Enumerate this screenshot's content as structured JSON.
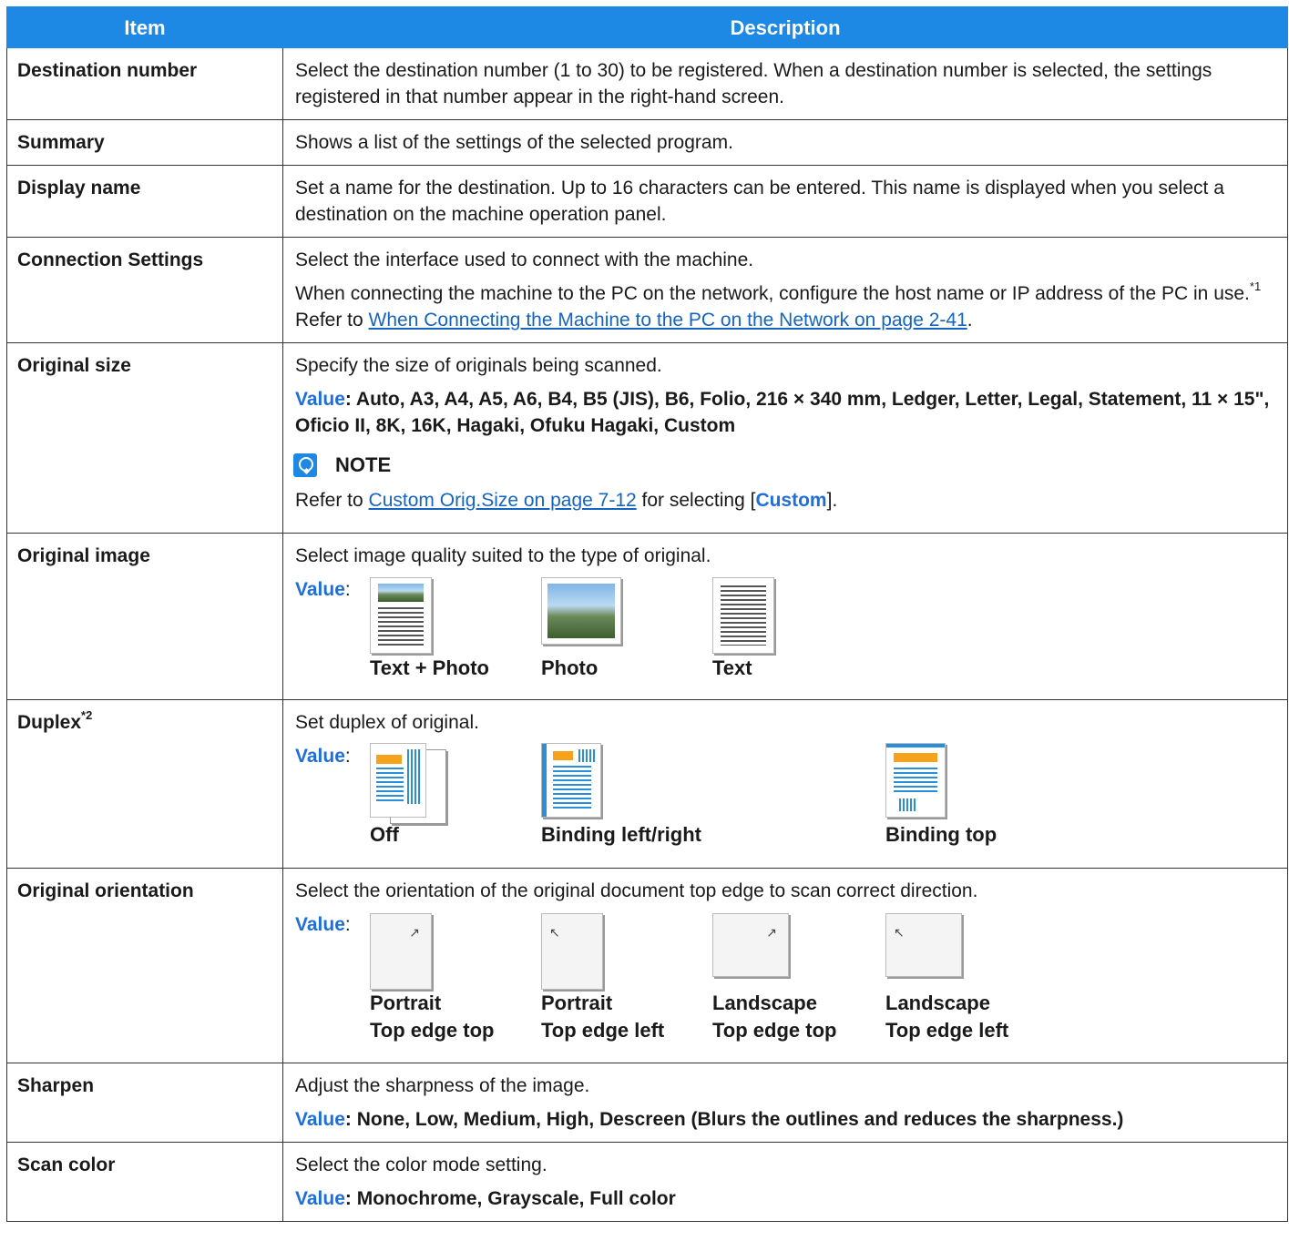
{
  "header": {
    "item": "Item",
    "description": "Description"
  },
  "rows": {
    "destination_number": {
      "item": "Destination number",
      "desc": "Select the destination number (1 to 30) to be registered. When a destination number is selected, the settings registered in that number appear in the right-hand screen."
    },
    "summary": {
      "item": "Summary",
      "desc": "Shows a list of the settings of the selected program."
    },
    "display_name": {
      "item": "Display name",
      "desc": "Set a name for the destination. Up to 16 characters can be entered. This name is displayed when you select a destination on the machine operation panel."
    },
    "connection_settings": {
      "item": "Connection Settings",
      "desc1": "Select the interface used to connect with the machine.",
      "desc2a": "When connecting the machine to the PC on the network, configure the host name or IP address of the PC in use.",
      "desc2_sup": "*1",
      "desc2b": " Refer to ",
      "link": "When Connecting the Machine to the PC on the Network on page 2-41",
      "desc2c": "."
    },
    "original_size": {
      "item": "Original size",
      "desc1": "Specify the size of originals being scanned.",
      "value_label": "Value",
      "value": ": Auto, A3, A4, A5, A6, B4, B5 (JIS), B6, Folio, 216 × 340 mm, Ledger, Letter, Legal, Statement, 11 × 15\", Oficio II, 8K, 16K, Hagaki, Ofuku Hagaki, Custom",
      "note_title": "NOTE",
      "note_pre": "Refer to ",
      "note_link": "Custom Orig.Size on page 7-12",
      "note_mid": " for selecting [",
      "note_bold": "Custom",
      "note_post": "]."
    },
    "original_image": {
      "item": "Original image",
      "desc": "Select image quality suited to the type of original.",
      "value_label": "Value",
      "options": [
        "Text + Photo",
        "Photo",
        "Text"
      ]
    },
    "duplex": {
      "item": "Duplex",
      "item_sup": "*2",
      "desc": "Set duplex of original.",
      "value_label": "Value",
      "options": [
        "Off",
        "Binding left/right",
        "Binding top"
      ]
    },
    "original_orientation": {
      "item": "Original orientation",
      "desc": "Select the orientation of the original document top edge to scan correct direction.",
      "value_label": "Value",
      "options": [
        {
          "l1": "Portrait",
          "l2": "Top edge top"
        },
        {
          "l1": "Portrait",
          "l2": "Top edge left"
        },
        {
          "l1": "Landscape",
          "l2": "Top edge top"
        },
        {
          "l1": "Landscape",
          "l2": "Top edge left"
        }
      ]
    },
    "sharpen": {
      "item": "Sharpen",
      "desc": "Adjust the sharpness of the image.",
      "value_label": "Value",
      "value": ": None, Low, Medium, High, Descreen (Blurs the outlines and reduces the sharpness.)"
    },
    "scan_color": {
      "item": "Scan color",
      "desc": "Select the color mode setting.",
      "value_label": "Value",
      "value": ": Monochrome, Grayscale, Full color"
    }
  },
  "colors": {
    "header_bg": "#1e88e5",
    "value_label": "#1e6fd9",
    "link": "#1565c0"
  }
}
